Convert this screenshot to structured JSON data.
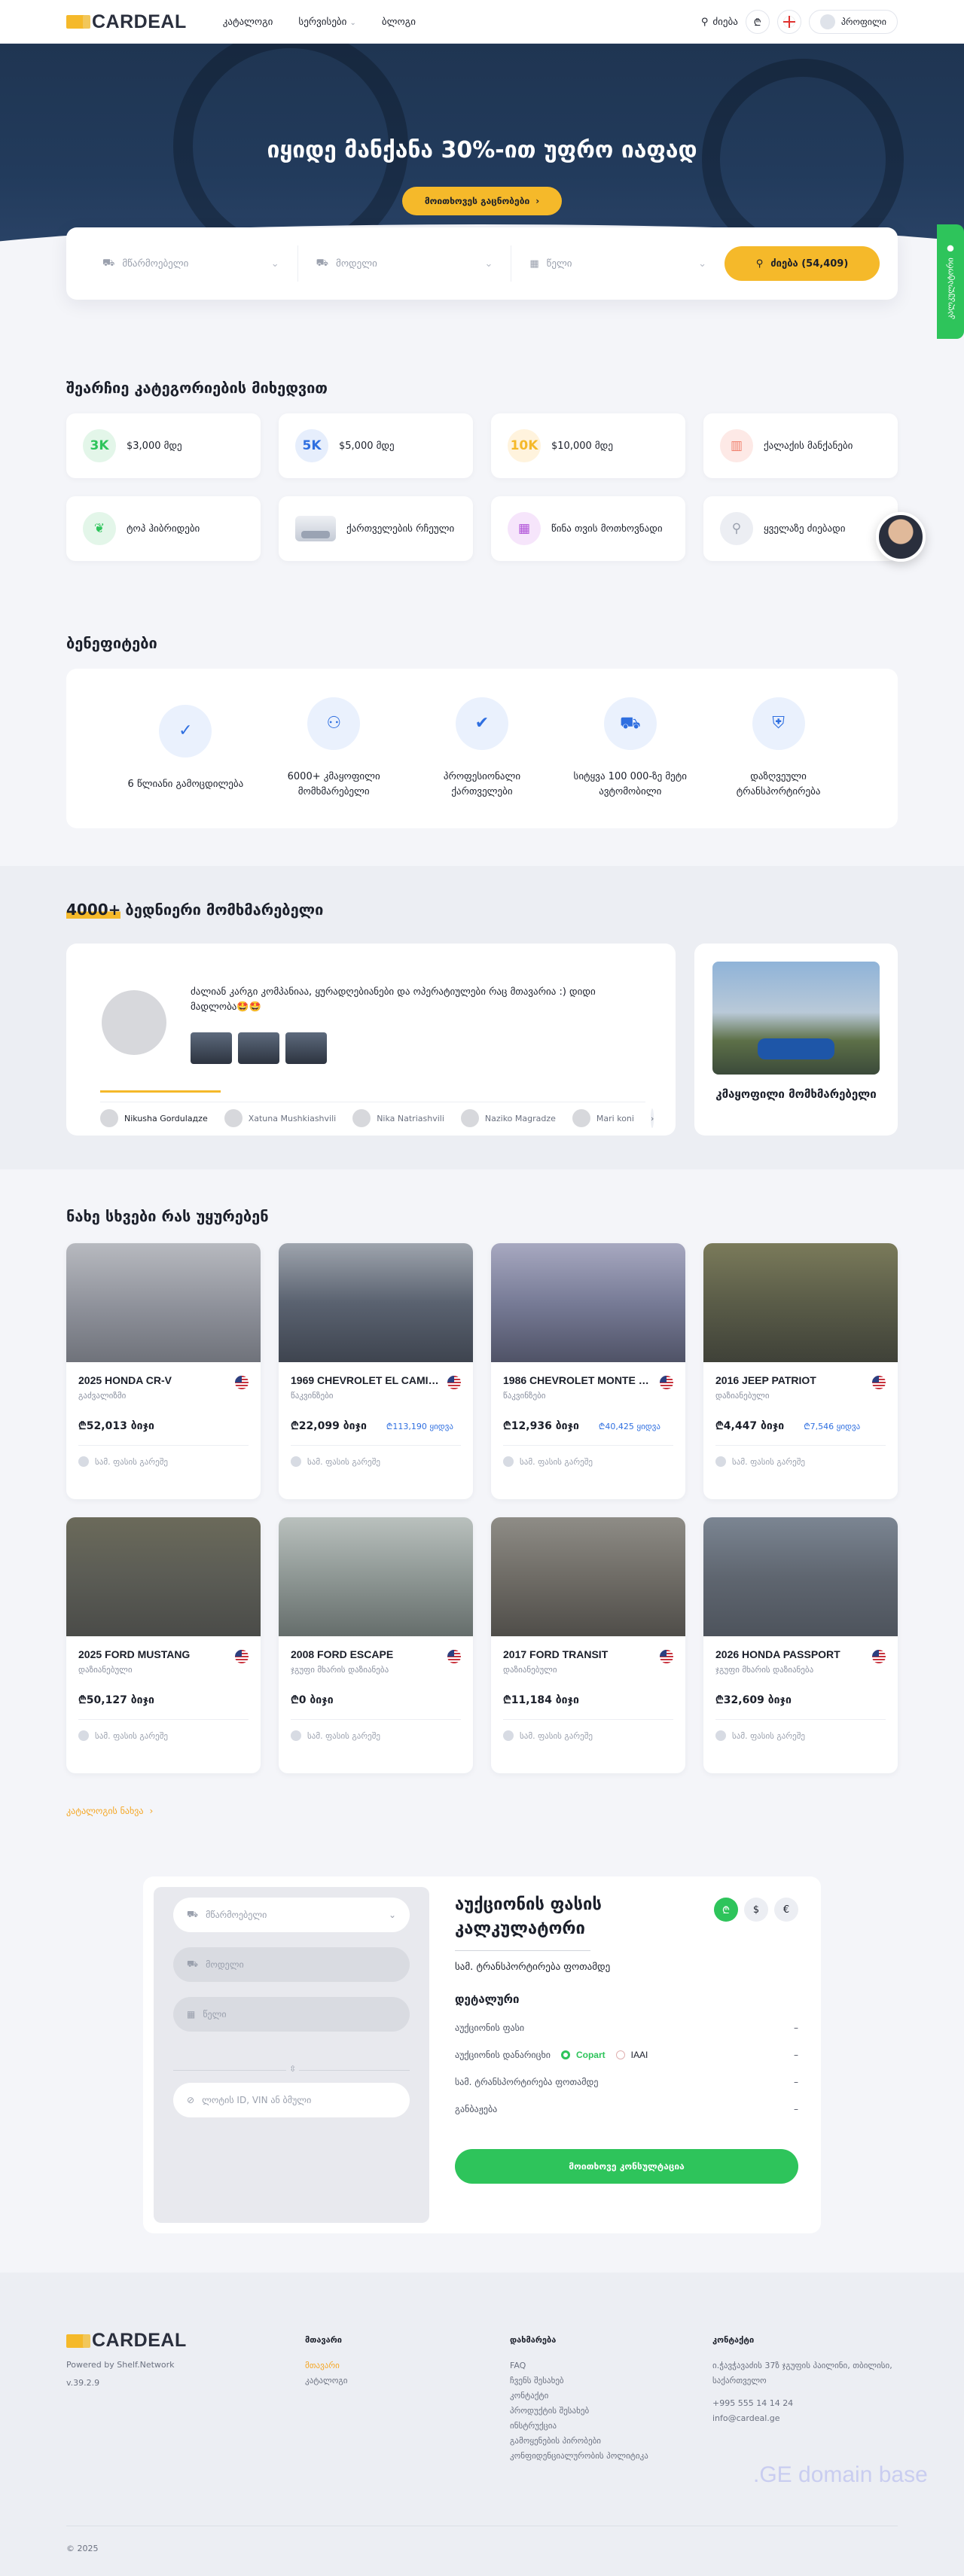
{
  "header": {
    "logo": "CARDEAL",
    "nav": [
      "კატალოგი",
      "სერვისები",
      "ბლოგი"
    ],
    "search": "ძიება",
    "currency": "₾",
    "profile": "პროფილი"
  },
  "hero": {
    "title": "იყიდე მანქანა 30%-ით უფრო იაფად",
    "button": "მოითხოვეს გაცნობები"
  },
  "search": {
    "make": "მწარმოებელი",
    "model": "მოდელი",
    "year": "წელი",
    "button": "ძიება (54,409)"
  },
  "side_tab": "კალკულატორი",
  "categories": {
    "title": "შეარჩიე კატეგორიების მიხედვით",
    "items": [
      {
        "icon": "3K",
        "label": "$3,000 მდე",
        "bg": "#e3f6e9",
        "color": "#2ec45b"
      },
      {
        "icon": "5K",
        "label": "$5,000 მდე",
        "bg": "#e6eefc",
        "color": "#2f6fe0"
      },
      {
        "icon": "10K",
        "label": "$10,000 მდე",
        "bg": "#fff3dd",
        "color": "#f5b92a"
      },
      {
        "icon": "building-icon",
        "label": "ქალაქის მანქანები",
        "bg": "#fde9e6",
        "color": "#f07c68"
      },
      {
        "icon": "leaf-icon",
        "label": "ტოპ ჰიბრიდები",
        "bg": "#e3f6e9",
        "color": "#2ec45b"
      },
      {
        "icon": "car-icon",
        "label": "ქართველების რჩეული",
        "bg": "",
        "color": ""
      },
      {
        "icon": "calendar-icon",
        "label": "წინა თვის მოთხოვნადი",
        "bg": "#f6e5fb",
        "color": "#b052d8"
      },
      {
        "icon": "search-icon",
        "label": "ყველაზე ძიებადი",
        "bg": "#eceef3",
        "color": "#9aa0ad"
      }
    ]
  },
  "benefits": {
    "title": "ბენეფიტები",
    "items": [
      {
        "icon": "check-badge-icon",
        "label": "6 წლიანი გამოცდილება"
      },
      {
        "icon": "users-icon",
        "label": "6000+ კმაყოფილი მომხმარებელი"
      },
      {
        "icon": "user-check-icon",
        "label": "პროფესიონალი ქართველები"
      },
      {
        "icon": "car-icon",
        "label": "სიტყვა 100 000-ზე მეტი ავტომობილი"
      },
      {
        "icon": "shield-icon",
        "label": "დაზღვეული ტრანსპორტირება"
      }
    ]
  },
  "users": {
    "count": "4000+",
    "title_rest": "ბედნიერი მომხმარებელი",
    "review": "ძალიან კარგი კომპანიაა, ყურადღებიანები და ოპერატიულები რაც მთავარია :) დიდი მადლობა🤩🤩",
    "reviewers": [
      "Nikusha Gordulaдze",
      "Xatuna Mushkiashvili",
      "Nika Natriashvili",
      "Naziko Magradze",
      "Mari koni"
    ],
    "happy_label": "კმაყოფილი მომხმარებელი"
  },
  "listings": {
    "title": "ნახე სხვები რას უყურებენ",
    "more": "კატალოგის ნახვა",
    "footer_note": "სამ. ფასის გარეშე",
    "items": [
      {
        "title": "2025 HONDA CR-V",
        "sub": "გაძვალიზმი",
        "price": "₾52,013 ბიჯი",
        "alt": "",
        "img": "linear-gradient(180deg,#b7b9bf 0%,#8d9099 55%,#6f727a 100%)"
      },
      {
        "title": "1969 CHEVROLET EL CAMINO",
        "sub": "წაკვინზები",
        "price": "₾22,099 ბიჯი",
        "alt": "₾113,190 ყიდვა",
        "img": "linear-gradient(180deg,#9ea4ad 0%,#5a6270 50%,#3e444f 100%)"
      },
      {
        "title": "1986 CHEVROLET MONTE CARLO",
        "sub": "წაკვინზები",
        "price": "₾12,936 ბიჯი",
        "alt": "₾40,425 ყიდვა",
        "img": "linear-gradient(180deg,#a7a8c0 0%,#777b96 50%,#4f5266 100%)"
      },
      {
        "title": "2016 JEEP PATRIOT",
        "sub": "დაზიანებული",
        "price": "₾4,447 ბიჯი",
        "alt": "₾7,546 ყიდვა",
        "img": "linear-gradient(180deg,#7a7a5a 0%,#5a5c48 50%,#3f4138 100%)"
      },
      {
        "title": "2025 FORD MUSTANG",
        "sub": "დაზიანებული",
        "price": "₾50,127 ბიჯი",
        "alt": "",
        "img": "linear-gradient(180deg,#6b6a5a 0%,#5b5c55 50%,#4a4b48 100%)"
      },
      {
        "title": "2008 FORD ESCAPE",
        "sub": "ჯგუფი მხარის დაზიანება",
        "price": "₾0 ბიჯი",
        "alt": "",
        "img": "linear-gradient(180deg,#b9c0bd 0%,#8e9794 50%,#656d6b 100%)"
      },
      {
        "title": "2017 FORD TRANSIT",
        "sub": "დაზიანებული",
        "price": "₾11,184 ბიჯი",
        "alt": "",
        "img": "linear-gradient(180deg,#8e8c86 0%,#6f6c66 50%,#4f4d49 100%)"
      },
      {
        "title": "2026 HONDA PASSPORT",
        "sub": "ჯგუფი მხარის დაზიანება",
        "price": "₾32,609 ბიჯი",
        "alt": "",
        "img": "linear-gradient(180deg,#7b8592 0%,#5f6670 50%,#4d535c 100%)"
      }
    ]
  },
  "calculator": {
    "make": "მწარმოებელი",
    "model": "მოდელი",
    "year": "წელი",
    "lot": "ლოტის ID, VIN ან ბმული",
    "title": "აუქციონის ფასის კალკულატორი",
    "currencies": [
      "₾",
      "$",
      "€"
    ],
    "subtitle": "სამ. ტრანსპორტირება ფოთამდე",
    "details": "დეტალური",
    "rows": [
      {
        "label": "აუქციონის ფასი",
        "value": "–"
      },
      {
        "label": "აუქციონის დანარიცხი",
        "value": "–"
      },
      {
        "label": "სამ. ტრანსპორტირება ფოთამდე",
        "value": "–"
      },
      {
        "label": "განბაჟება",
        "value": "–"
      }
    ],
    "copart": "Copart",
    "iaai": "IAAI",
    "button": "მოითხოვე კონსულტაცია"
  },
  "footer": {
    "logo": "CARDEAL",
    "powered": "Powered by Shelf.Network",
    "version": "v.39.2.9",
    "col1": {
      "title": "მთავარი",
      "items": [
        "მთავარი",
        "კატალოგი"
      ]
    },
    "col2": {
      "title": "დახმარება",
      "items": [
        "FAQ",
        "ჩვენს შესახებ",
        "კონტაქტი",
        "პროდუქტის შესახებ",
        "ინსტრუქცია",
        "გამოყენების პირობები",
        "კონფიდენციალურობის პოლიტიკა"
      ]
    },
    "col3": {
      "title": "კონტაქტი",
      "items": [
        "ი.ჭავჭავაძის 37ზ ჯგუფის პაილინი, თბილისი, საქართველო",
        "+995 555 14 14 24",
        "info@cardeal.ge"
      ]
    },
    "watermark": ".GE domain base",
    "copyright": "© 2025"
  }
}
